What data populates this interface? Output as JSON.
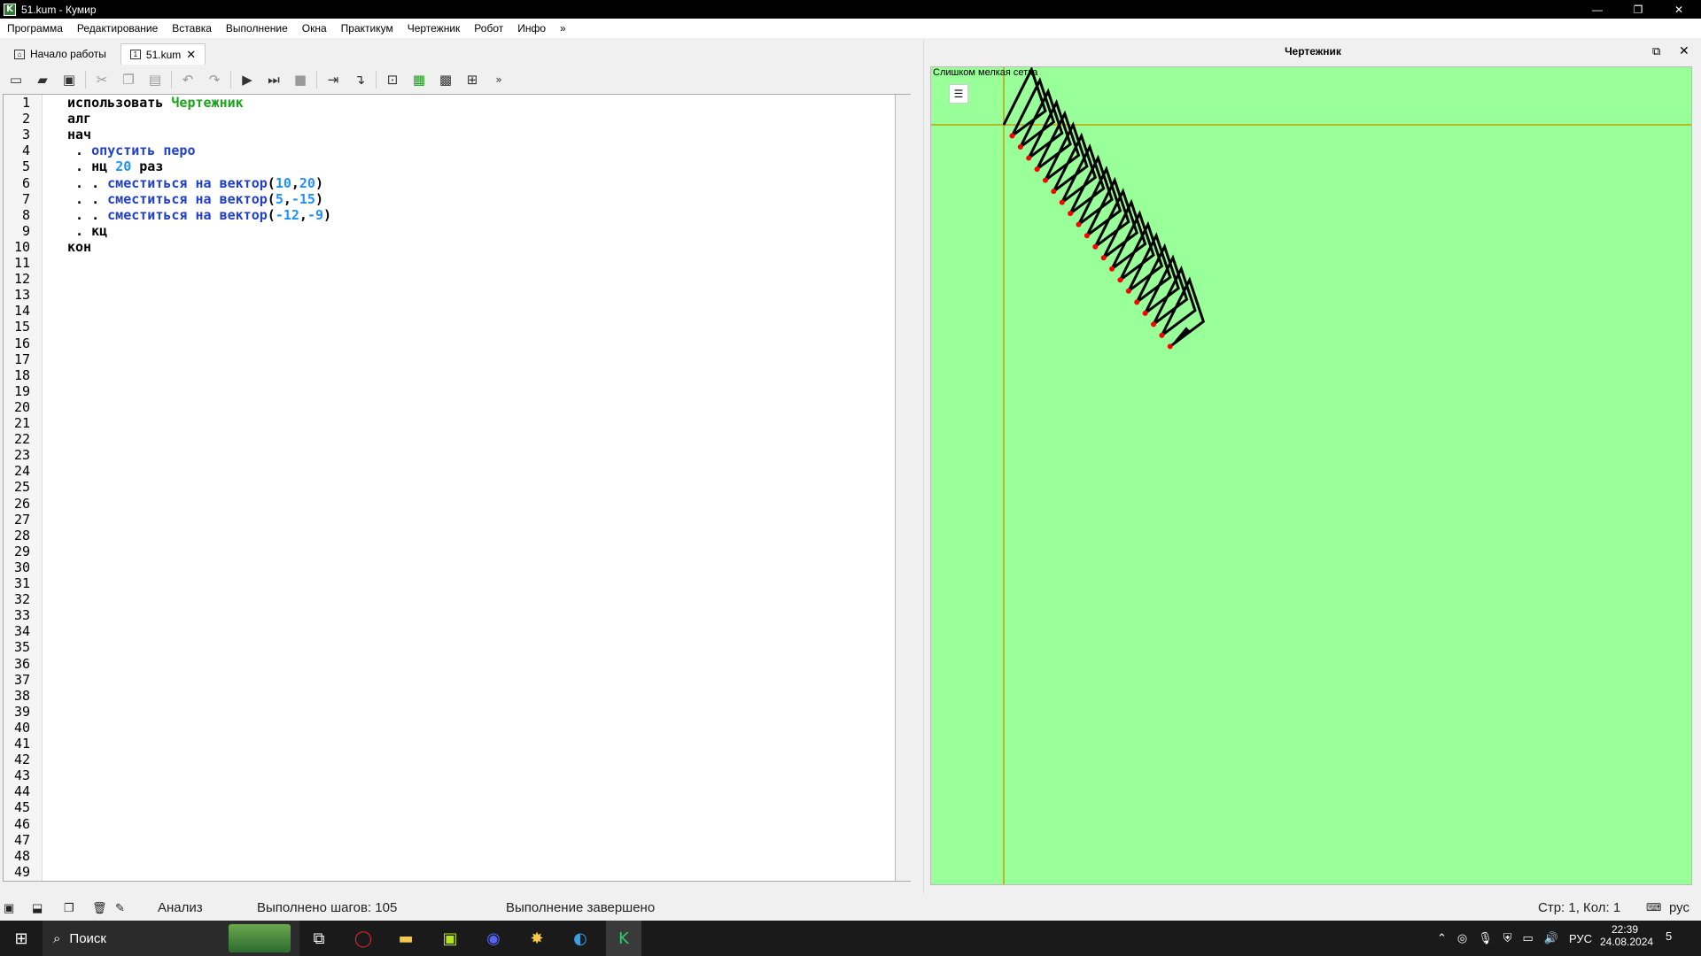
{
  "window": {
    "title": "51.kum - Кумир",
    "app_icon": "K"
  },
  "menu": [
    "Программа",
    "Редактирование",
    "Вставка",
    "Выполнение",
    "Окна",
    "Практикум",
    "Чертежник",
    "Робот",
    "Инфо",
    "»"
  ],
  "tabs": [
    {
      "label": "Начало работы",
      "icon": "home"
    },
    {
      "label": "51.kum",
      "icon": "doc",
      "close": "✕"
    }
  ],
  "toolbar": {
    "overflow": "»"
  },
  "editor": {
    "line_count": 49,
    "lines": [
      {
        "n": 1,
        "tokens": [
          [
            "kw",
            "использовать "
          ],
          [
            "mod",
            "Чертежник"
          ]
        ]
      },
      {
        "n": 2,
        "tokens": [
          [
            "kw",
            "алг"
          ]
        ]
      },
      {
        "n": 3,
        "tokens": [
          [
            "kw",
            "нач"
          ]
        ]
      },
      {
        "n": 4,
        "tokens": [
          [
            "kw",
            " . "
          ],
          [
            "cmd",
            "опустить перо"
          ]
        ]
      },
      {
        "n": 5,
        "tokens": [
          [
            "kw",
            " . нц "
          ],
          [
            "num",
            "20"
          ],
          [
            "kw",
            " раз"
          ]
        ]
      },
      {
        "n": 6,
        "tokens": [
          [
            "kw",
            " . . "
          ],
          [
            "cmd",
            "сместиться на вектор"
          ],
          [
            "kw",
            "("
          ],
          [
            "num",
            "10"
          ],
          [
            "kw",
            ","
          ],
          [
            "num",
            "20"
          ],
          [
            "kw",
            ")"
          ]
        ]
      },
      {
        "n": 7,
        "tokens": [
          [
            "kw",
            " . . "
          ],
          [
            "cmd",
            "сместиться на вектор"
          ],
          [
            "kw",
            "("
          ],
          [
            "num",
            "5"
          ],
          [
            "kw",
            ","
          ],
          [
            "num",
            "-15"
          ],
          [
            "kw",
            ")"
          ]
        ]
      },
      {
        "n": 8,
        "tokens": [
          [
            "kw",
            " . . "
          ],
          [
            "cmd",
            "сместиться на вектор"
          ],
          [
            "kw",
            "("
          ],
          [
            "num",
            "-12"
          ],
          [
            "kw",
            ","
          ],
          [
            "num",
            "-9"
          ],
          [
            "kw",
            ")"
          ]
        ]
      },
      {
        "n": 9,
        "tokens": [
          [
            "kw",
            " . кц"
          ]
        ]
      },
      {
        "n": 10,
        "tokens": [
          [
            "kw",
            "кон"
          ]
        ]
      }
    ]
  },
  "drawer": {
    "title": "Чертежник",
    "grid_note": "Слишком мелкая сетка",
    "loop_count": 20,
    "vectors": [
      [
        10,
        20
      ],
      [
        5,
        -15
      ],
      [
        -12,
        -9
      ]
    ],
    "colors": {
      "background": "#99ff99",
      "axis": "#c0a000",
      "pen": "#000000",
      "marker": "#ff0000"
    }
  },
  "status": {
    "mode": "Анализ",
    "steps": "Выполнено шагов: 105",
    "state": "Выполнение завершено",
    "cursor": "Стр: 1, Кол: 1",
    "lang": "рус"
  },
  "taskbar": {
    "search": "Поиск",
    "lang": "РУС",
    "time": "22:39",
    "date": "24.08.2024",
    "notif": "5"
  }
}
